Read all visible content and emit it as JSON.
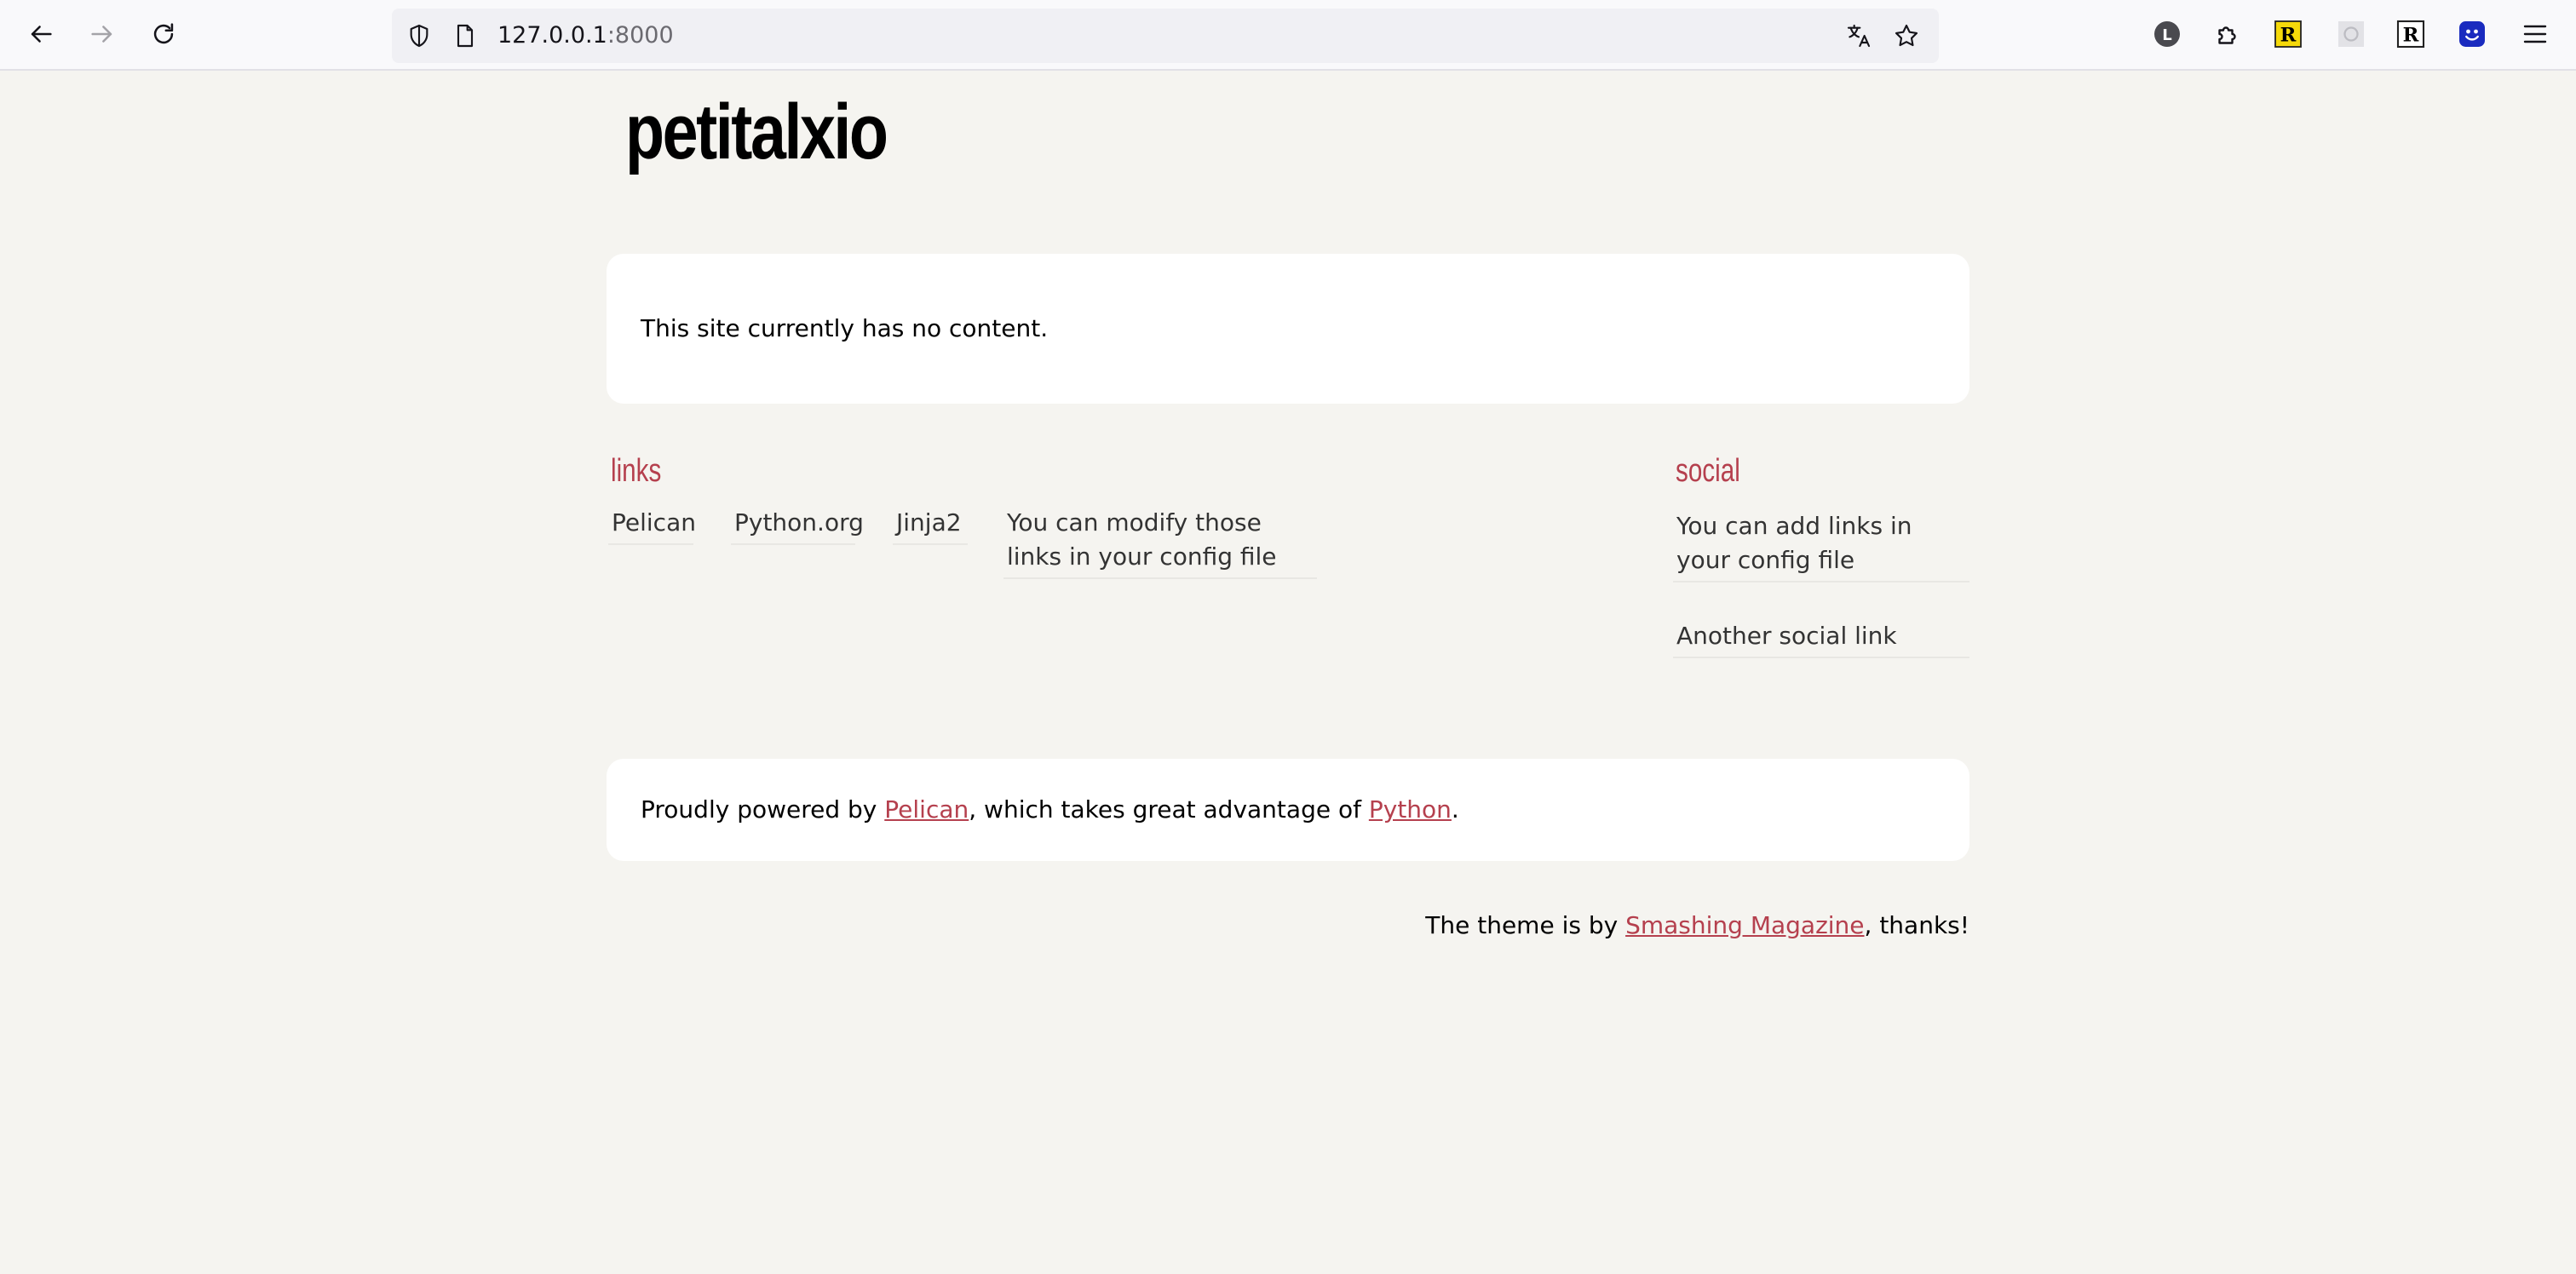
{
  "browser": {
    "url_host": "127.0.0.1",
    "url_port": ":8000"
  },
  "site": {
    "title": "petitalxio"
  },
  "main": {
    "empty_message": "This site currently has no content."
  },
  "links": {
    "heading": "links",
    "items": [
      "Pelican",
      "Python.org",
      "Jinja2",
      "You can modify those links in your config file"
    ]
  },
  "social": {
    "heading": "social",
    "items": [
      "You can add links in your config file",
      "Another social link"
    ]
  },
  "footer": {
    "prefix": "Proudly powered by ",
    "pelican": "Pelican",
    "middle": ", which takes great advantage of ",
    "python": "Python",
    "suffix": "."
  },
  "credit": {
    "prefix": "The theme is by ",
    "link": "Smashing Magazine",
    "suffix": ", thanks!"
  },
  "colors": {
    "accent": "#b5404e",
    "page_background": "#f5f4f0",
    "card_background": "#ffffff"
  }
}
